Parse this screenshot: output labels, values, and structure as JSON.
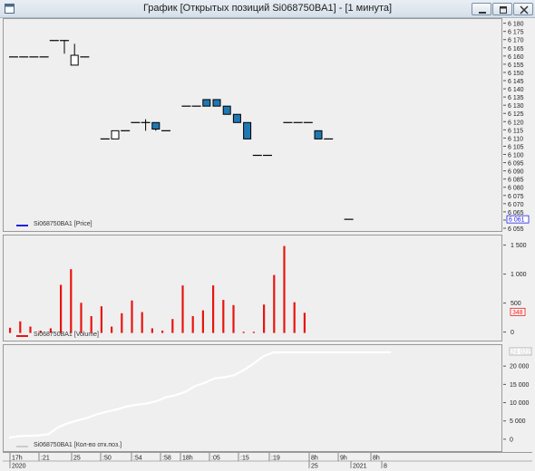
{
  "window": {
    "title": "График [Открытых позиций Si068750BA1] - [1 минута]"
  },
  "icons": {
    "app": "chart-window-icon",
    "minimize": "minimize-icon",
    "maximize": "maximize-icon",
    "close": "close-icon"
  },
  "colors": {
    "candle_up": "#ffffff",
    "candle_down": "#1f78b4",
    "volume_bar": "#e8150f",
    "open_positions_line": "#ffffff",
    "price_legend": "#2020e0",
    "volume_legend": "#e8150f",
    "background": "#efefef"
  },
  "price_panel": {
    "legend": "Si068750BA1 [Price]",
    "current_price": "6 061",
    "ticks": [
      "6 180",
      "6 175",
      "6 170",
      "6 165",
      "6 160",
      "6 155",
      "6 150",
      "6 145",
      "6 140",
      "6 135",
      "6 130",
      "6 125",
      "6 120",
      "6 115",
      "6 110",
      "6 105",
      "6 100",
      "6 095",
      "6 090",
      "6 085",
      "6 080",
      "6 075",
      "6 070",
      "6 065",
      "6 060",
      "6 055"
    ]
  },
  "volume_panel": {
    "legend": "Si068750BA1 [Volume]",
    "current_volume": "348",
    "ticks": [
      "1 500",
      "1 000",
      "500",
      "0"
    ]
  },
  "oi_panel": {
    "legend": "Si068750BA1 [Кол-во отк.поз.]",
    "current_value": "24 022",
    "ticks": [
      "20 000",
      "15 000",
      "10 000",
      "5 000",
      "0"
    ]
  },
  "time_axis": {
    "row1": [
      "17h",
      ":21",
      "25",
      ":50",
      ":54",
      ":58",
      "18h",
      ":05",
      ":15",
      ":19",
      "8h",
      "9h",
      "8h"
    ],
    "row2": [
      "2020",
      "25",
      "2021",
      "8"
    ]
  },
  "chart_data": [
    {
      "type": "candlestick",
      "name": "Si068750BA1 [Price]",
      "ylim": [
        6055,
        6182
      ],
      "candles": [
        {
          "o": 6160,
          "h": 6160,
          "l": 6160,
          "c": 6160
        },
        {
          "o": 6160,
          "h": 6160,
          "l": 6160,
          "c": 6160
        },
        {
          "o": 6160,
          "h": 6160,
          "l": 6160,
          "c": 6160
        },
        {
          "o": 6160,
          "h": 6160,
          "l": 6160,
          "c": 6160
        },
        {
          "o": 6170,
          "h": 6170,
          "l": 6170,
          "c": 6170
        },
        {
          "o": 6170,
          "h": 6170,
          "l": 6162,
          "c": 6170
        },
        {
          "o": 6155,
          "h": 6168,
          "l": 6155,
          "c": 6161
        },
        {
          "o": 6160,
          "h": 6160,
          "l": 6160,
          "c": 6160
        },
        null,
        {
          "o": 6110,
          "h": 6110,
          "l": 6110,
          "c": 6110
        },
        {
          "o": 6110,
          "h": 6115,
          "l": 6110,
          "c": 6115
        },
        {
          "o": 6115,
          "h": 6115,
          "l": 6115,
          "c": 6115
        },
        {
          "o": 6120,
          "h": 6120,
          "l": 6120,
          "c": 6120
        },
        {
          "o": 6120,
          "h": 6122,
          "l": 6115,
          "c": 6120
        },
        {
          "o": 6120,
          "h": 6120,
          "l": 6115,
          "c": 6116
        },
        {
          "o": 6115,
          "h": 6115,
          "l": 6115,
          "c": 6115
        },
        null,
        {
          "o": 6130,
          "h": 6130,
          "l": 6130,
          "c": 6130
        },
        {
          "o": 6130,
          "h": 6130,
          "l": 6130,
          "c": 6130
        },
        {
          "o": 6134,
          "h": 6134,
          "l": 6130,
          "c": 6130
        },
        {
          "o": 6134,
          "h": 6134,
          "l": 6130,
          "c": 6130
        },
        {
          "o": 6130,
          "h": 6130,
          "l": 6125,
          "c": 6125
        },
        {
          "o": 6125,
          "h": 6125,
          "l": 6120,
          "c": 6120
        },
        {
          "o": 6120,
          "h": 6120,
          "l": 6110,
          "c": 6110
        },
        {
          "o": 6100,
          "h": 6100,
          "l": 6100,
          "c": 6100
        },
        {
          "o": 6100,
          "h": 6100,
          "l": 6100,
          "c": 6100
        },
        null,
        {
          "o": 6120,
          "h": 6120,
          "l": 6120,
          "c": 6120
        },
        {
          "o": 6120,
          "h": 6120,
          "l": 6120,
          "c": 6120
        },
        {
          "o": 6120,
          "h": 6120,
          "l": 6120,
          "c": 6120
        },
        {
          "o": 6115,
          "h": 6115,
          "l": 6110,
          "c": 6110
        },
        {
          "o": 6110,
          "h": 6110,
          "l": 6110,
          "c": 6110
        },
        null,
        {
          "o": 6061,
          "h": 6061,
          "l": 6061,
          "c": 6061
        }
      ]
    },
    {
      "type": "bar",
      "name": "Si068750BA1 [Volume]",
      "ylim": [
        -100,
        1650
      ],
      "values": [
        90,
        200,
        110,
        40,
        80,
        830,
        1100,
        520,
        290,
        460,
        110,
        340,
        560,
        360,
        80,
        40,
        240,
        820,
        290,
        390,
        820,
        570,
        480,
        20,
        20,
        490,
        1000,
        1500,
        530,
        348
      ]
    },
    {
      "type": "line",
      "name": "Si068750BA1 [Кол-во отк.поз.]",
      "ylim": [
        -2500,
        25500
      ],
      "values": [
        700,
        1100,
        1200,
        1300,
        1600,
        3500,
        4600,
        5400,
        6100,
        7100,
        7800,
        8400,
        9200,
        9700,
        10000,
        10600,
        11700,
        12300,
        13200,
        14800,
        15700,
        16900,
        17200,
        17800,
        19200,
        21000,
        23000,
        24000,
        24022,
        24022,
        24022,
        24022,
        24022,
        24022,
        24022,
        24022,
        24022,
        24022,
        24022,
        24022
      ]
    }
  ]
}
